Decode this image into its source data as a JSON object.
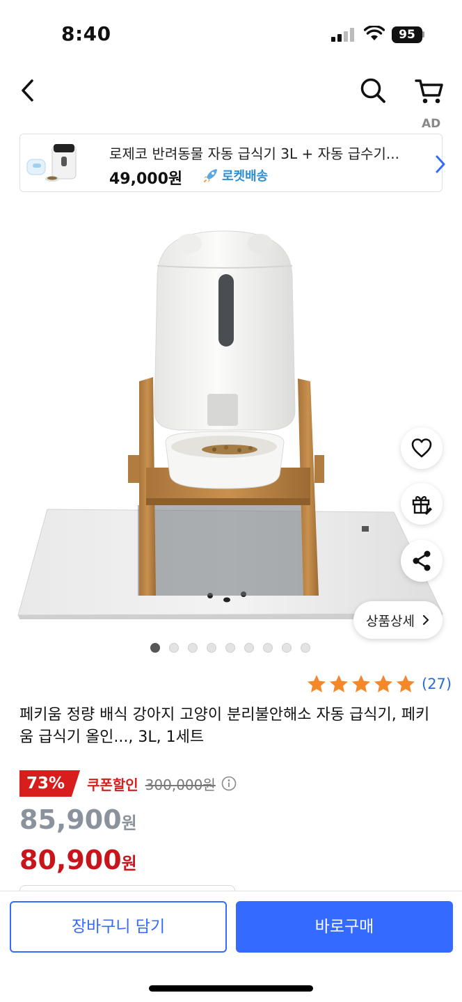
{
  "status_bar": {
    "time": "8:40",
    "battery": "95"
  },
  "nav": {
    "icons": [
      "back-arrow-icon",
      "search-icon",
      "cart-icon"
    ]
  },
  "ad": {
    "tag": "AD",
    "title": "로제코 반려동물 자동 급식기 3L + 자동 급수기...",
    "price": "49,000원",
    "delivery": "로켓배송"
  },
  "gallery": {
    "total": 9,
    "active_index": 0
  },
  "actions": {
    "detail_label": "상품상세"
  },
  "rating": {
    "stars": 5,
    "count": "(27)"
  },
  "product": {
    "title": "페키움 정량 배식 강아지 고양이 분리불안해소 자동 급식기, 페키움 급식기 올인..., 3L, 1세트",
    "discount_pct": "73%",
    "coupon_label": "쿠폰할인",
    "original_price": "300,000원",
    "sale_price_number": "85,900",
    "final_price_number": "80,900",
    "currency": "원"
  },
  "buttons": {
    "add_to_cart": "장바구니 담기",
    "buy_now": "바로구매"
  },
  "colors": {
    "accent_blue": "#346aff",
    "discount_red": "#d81d1d",
    "star_orange": "#f5892a"
  }
}
